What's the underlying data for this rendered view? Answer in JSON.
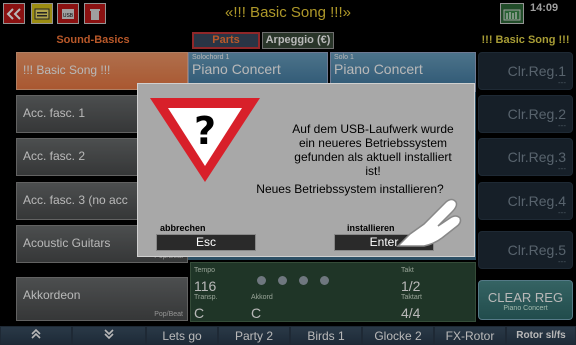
{
  "topbar": {
    "title": "«!!! Basic Song !!!»",
    "time": "14:09",
    "icons": [
      "back-icon",
      "folder-icon",
      "usb-icon",
      "trash-icon",
      "organ-icon"
    ]
  },
  "header": {
    "left_label": "Sound-Basics",
    "tabs": [
      {
        "label": "Parts",
        "active": true
      },
      {
        "label": "Arpeggio (€)",
        "active": false
      }
    ],
    "right_label": "!!! Basic Song !!!"
  },
  "sound_list": [
    {
      "label": "!!! Basic Song !!!",
      "tag": "",
      "selected": true
    },
    {
      "label": "Acc. fasc. 1",
      "tag": "",
      "selected": false
    },
    {
      "label": "Acc. fasc. 2",
      "tag": "",
      "selected": false
    },
    {
      "label": "Acc. fasc. 3 (no acc",
      "tag": "",
      "selected": false
    },
    {
      "label": "Acoustic Guitars",
      "tag": "Pop/Beat",
      "selected": false
    },
    {
      "label": "Akkordeon",
      "tag": "Pop/Beat",
      "selected": false
    }
  ],
  "parts": [
    {
      "label": "Solochord 1",
      "value": "Piano Concert"
    },
    {
      "label": "Solo 1",
      "value": "Piano Concert"
    }
  ],
  "registrations": [
    {
      "label": "Clr.Reg.1",
      "sub": "---"
    },
    {
      "label": "Clr.Reg.2",
      "sub": "---"
    },
    {
      "label": "Clr.Reg.3",
      "sub": "---"
    },
    {
      "label": "Clr.Reg.4",
      "sub": "---"
    },
    {
      "label": "Clr.Reg.5",
      "sub": "---"
    }
  ],
  "clear_reg": {
    "label": "CLEAR REG",
    "sub": "Piano Concert"
  },
  "info": {
    "tempo_label": "Tempo",
    "tempo": "116",
    "transp_label": "Transp.",
    "transp": "C",
    "akkord_label": "Akkord",
    "akkord": "C",
    "takt_label": "Takt",
    "takt": "1/2",
    "taktart_label": "Taktart",
    "taktart": "4/4"
  },
  "bottom_nav": [
    "«up»",
    "«down»",
    "Lets go",
    "Party 2",
    "Birds 1",
    "Glocke 2",
    "FX-Rotor",
    "Rotor sl/fs"
  ],
  "dialog": {
    "message": "Auf dem USB-Laufwerk wurde ein neueres Betriebssystem gefunden als aktuell installiert ist!",
    "question": "Neues Betriebssystem installieren?",
    "cancel_caption": "abbrechen",
    "cancel_button": "Esc",
    "confirm_caption": "installieren",
    "confirm_button": "Enter"
  },
  "colors": {
    "title": "#f0d23a",
    "selected_item": "#ec7a44",
    "part_panel": "#4f88b0",
    "warning_red": "#d8202a"
  }
}
